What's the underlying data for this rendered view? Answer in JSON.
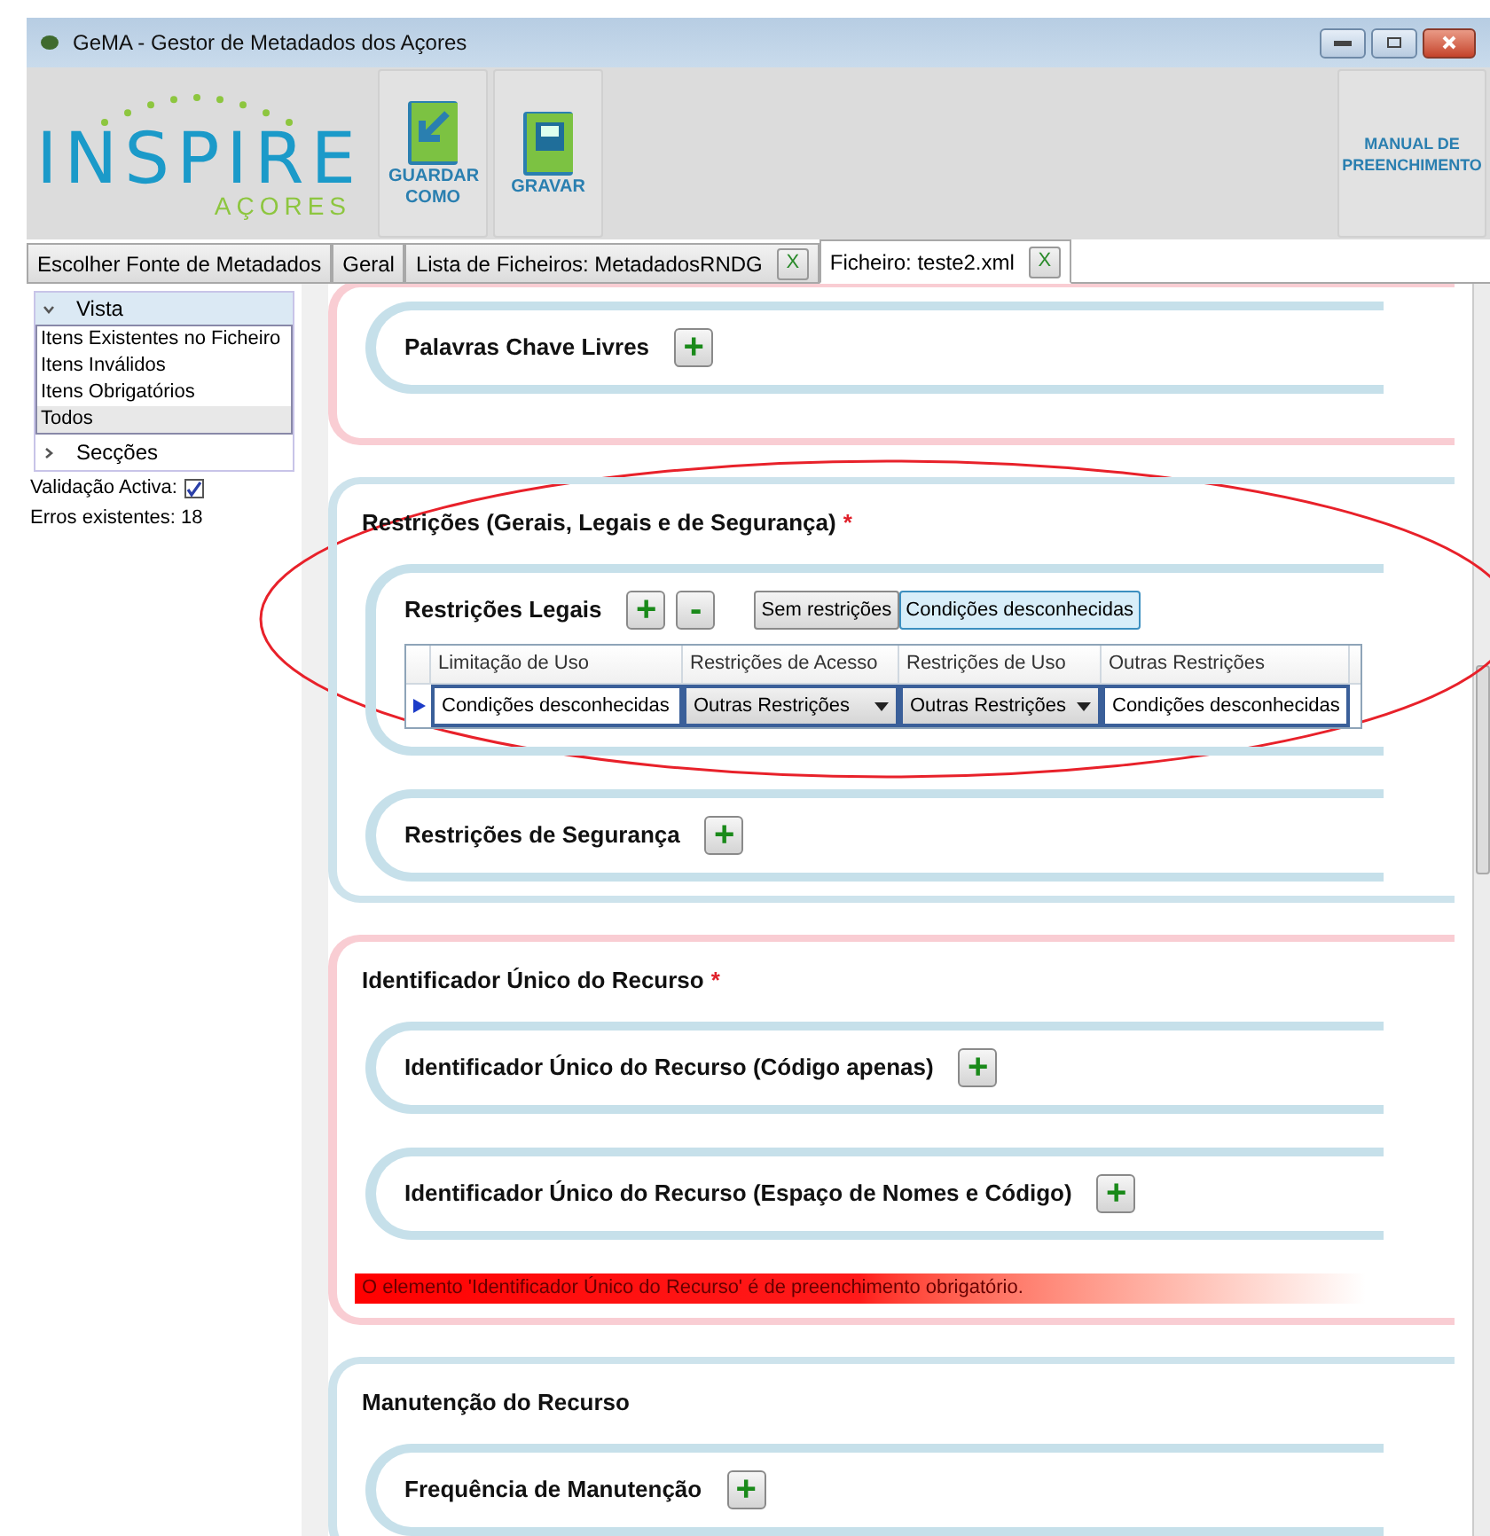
{
  "window": {
    "title": "GeMA - Gestor de Metadados dos Açores"
  },
  "logo": {
    "name": "INSPIRE",
    "subtitle": "AÇORES"
  },
  "toolbar": [
    {
      "label": "GUARDAR COMO",
      "kind": "save-as"
    },
    {
      "label": "GRAVAR",
      "kind": "save"
    }
  ],
  "manual_button": "MANUAL DE PREENCHIMENTO",
  "tabs": [
    {
      "label": "Escolher Fonte de Metadados",
      "selected": false
    },
    {
      "label": "Geral",
      "selected": false
    },
    {
      "label": "Lista de Ficheiros: MetadadosRNDG",
      "selected": false,
      "close_label": "X"
    },
    {
      "label": "Ficheiro: teste2.xml",
      "selected": true,
      "close_label": "X"
    }
  ],
  "sidebar": {
    "vista": {
      "label": "Vista",
      "expanded": true,
      "items": [
        {
          "label": "Itens Existentes no Ficheiro",
          "selected": false
        },
        {
          "label": "Itens Inválidos",
          "selected": false
        },
        {
          "label": "Itens Obrigatórios",
          "selected": false
        },
        {
          "label": "Todos",
          "selected": true
        }
      ]
    },
    "seccoes": {
      "label": "Secções",
      "expanded": false
    },
    "validation": {
      "label": "Validação Activa:",
      "checked": true
    },
    "errors": "Erros existentes: 18"
  },
  "groups": [
    {
      "invalid": true,
      "subsections": [
        {
          "kind": "simple",
          "title": "Palavras Chave Livres",
          "add": "+"
        }
      ]
    },
    {
      "title": "Restrições (Gerais, Legais e de Segurança)",
      "required": true,
      "invalid": false,
      "subsections": [
        {
          "kind": "table",
          "title": "Restrições Legais",
          "add": "+",
          "remove": "-",
          "options": [
            {
              "label": "Sem restrições",
              "selected": false
            },
            {
              "label": "Condições desconhecidas",
              "selected": true
            }
          ],
          "columns": [
            "Limitação de Uso",
            "Restrições de Acesso",
            "Restrições de Uso",
            "Outras Restrições"
          ],
          "rows": [
            {
              "current": true,
              "cells": [
                {
                  "kind": "text",
                  "value": "Condições desconhecidas"
                },
                {
                  "kind": "dropdown",
                  "value": "Outras Restrições"
                },
                {
                  "kind": "dropdown",
                  "value": "Outras Restrições"
                },
                {
                  "kind": "text",
                  "value": "Condições desconhecidas"
                }
              ]
            }
          ]
        },
        {
          "kind": "simple",
          "title": "Restrições de Segurança",
          "add": "+"
        }
      ]
    },
    {
      "title": "Identificador Único do Recurso",
      "required": true,
      "invalid": true,
      "error": "O elemento 'Identificador Único do Recurso' é de preenchimento obrigatório.",
      "subsections": [
        {
          "kind": "simple",
          "title": "Identificador Único do Recurso (Código apenas)",
          "add": "+"
        },
        {
          "kind": "simple",
          "title": "Identificador Único do Recurso (Espaço de Nomes e Código)",
          "add": "+"
        }
      ]
    },
    {
      "title": "Manutenção do Recurso",
      "required": false,
      "invalid": false,
      "subsections": [
        {
          "kind": "simple",
          "title": "Frequência de Manutenção",
          "add": "+"
        }
      ]
    }
  ],
  "required_mark": "*"
}
